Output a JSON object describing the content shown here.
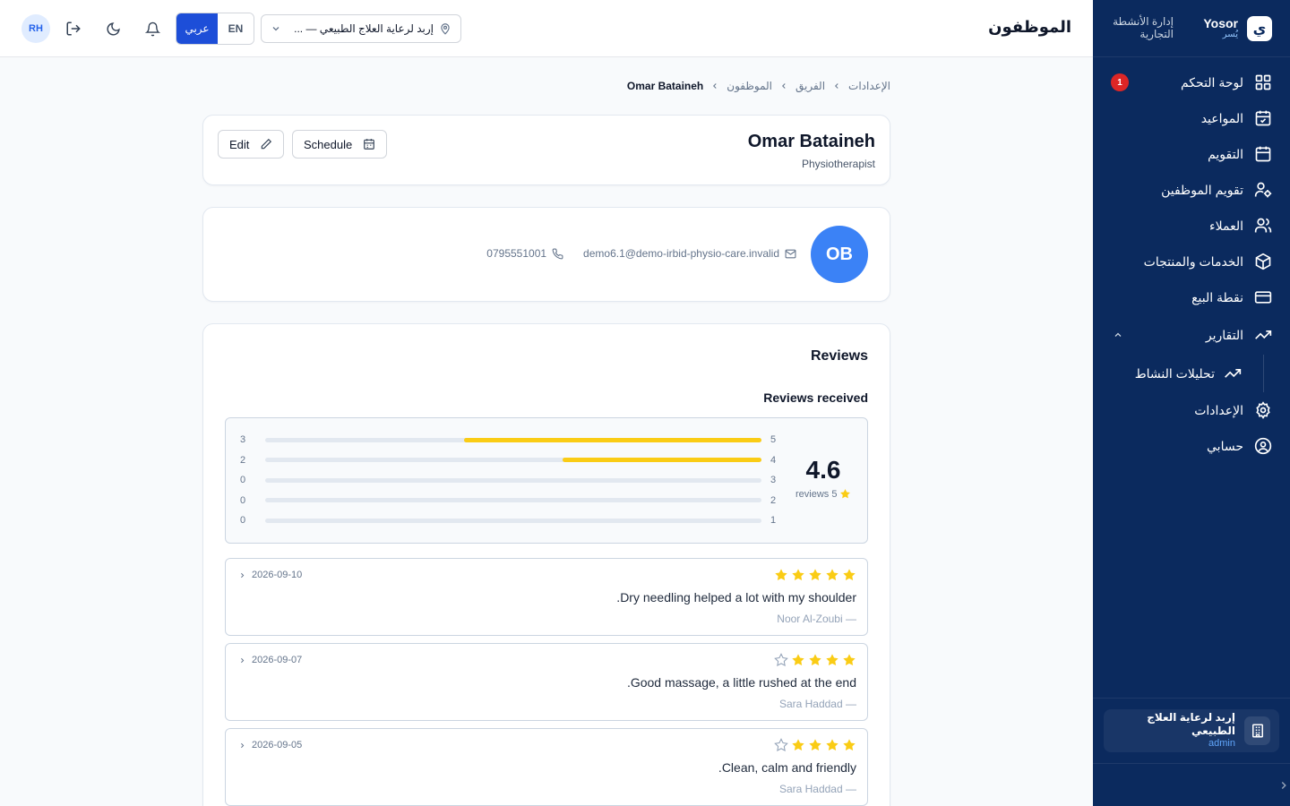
{
  "brand": {
    "name": "Yosor",
    "sub": "يُسر",
    "logo_char": "ي",
    "description": "إدارة الأنشطة التجارية"
  },
  "sidebar": {
    "items": [
      {
        "label": "لوحة التحكم",
        "icon": "dashboard-icon",
        "badge": "1"
      },
      {
        "label": "المواعيد",
        "icon": "calendar-check-icon"
      },
      {
        "label": "التقويم",
        "icon": "calendar-icon"
      },
      {
        "label": "تقويم الموظفين",
        "icon": "user-cog-icon"
      },
      {
        "label": "العملاء",
        "icon": "users-icon"
      },
      {
        "label": "الخدمات والمنتجات",
        "icon": "package-icon"
      },
      {
        "label": "نقطة البيع",
        "icon": "credit-card-icon"
      },
      {
        "label": "التقارير",
        "icon": "trending-up-icon",
        "expanded": true
      },
      {
        "label": "تحليلات النشاط",
        "icon": "trending-up-icon",
        "sub": true
      },
      {
        "label": "الإعدادات",
        "icon": "gear-icon"
      },
      {
        "label": "حسابي",
        "icon": "user-circle-icon"
      }
    ],
    "tenant": {
      "name": "إربد لرعاية العلاج الطبيعي",
      "role": "admin"
    }
  },
  "header": {
    "title": "الموظفون",
    "location": "إربد لرعاية العلاج الطبيعي — ...",
    "lang_ar": "عربي",
    "lang_en": "EN",
    "avatar": "RH"
  },
  "breadcrumb": [
    "الإعدادات",
    "الفريق",
    "الموظفون",
    "Omar Bataineh"
  ],
  "employee": {
    "name": "Omar Bataineh",
    "role": "Physiotherapist",
    "initials": "OB",
    "email": "demo6.1@demo-irbid-physio-care.invalid",
    "phone": "0795551001",
    "edit_label": "Edit",
    "schedule_label": "Schedule"
  },
  "reviews": {
    "title": "Reviews",
    "subtitle": "Reviews received",
    "average": "4.6",
    "count_label": "5 reviews",
    "distribution": [
      {
        "stars": 5,
        "count": 3,
        "fraction": 0.6
      },
      {
        "stars": 4,
        "count": 2,
        "fraction": 0.4
      },
      {
        "stars": 3,
        "count": 0,
        "fraction": 0
      },
      {
        "stars": 2,
        "count": 0,
        "fraction": 0
      },
      {
        "stars": 1,
        "count": 0,
        "fraction": 0
      }
    ],
    "items": [
      {
        "rating": 5,
        "text": "Dry needling helped a lot with my shoulder.",
        "author": "— Noor Al-Zoubi",
        "date": "2026-09-10"
      },
      {
        "rating": 4,
        "text": "Good massage, a little rushed at the end.",
        "author": "— Sara Haddad",
        "date": "2026-09-07"
      },
      {
        "rating": 4,
        "text": "Clean, calm and friendly.",
        "author": "— Sara Haddad",
        "date": "2026-09-05"
      }
    ]
  },
  "colors": {
    "sidebar": "#0b2a5e",
    "primary": "#1d4ed8",
    "star": "#facc15",
    "avatar": "#3b82f6",
    "badge": "#dc2626"
  }
}
